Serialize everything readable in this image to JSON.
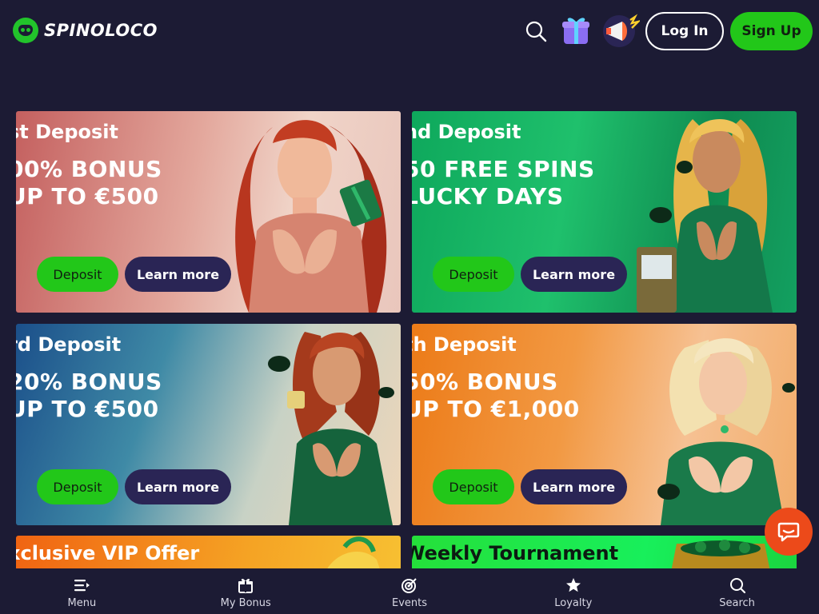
{
  "header": {
    "logo_text": "SPINOLOCO",
    "login_label": "Log In",
    "signup_label": "Sign Up"
  },
  "promos": [
    {
      "title": "st Deposit",
      "line1": "00% BONUS",
      "line2": "UP TO €500",
      "deposit_label": "Deposit",
      "learn_label": "Learn more"
    },
    {
      "title": "nd Deposit",
      "line1": "50 FREE SPINS",
      "line2": "LUCKY DAYS",
      "deposit_label": "Deposit",
      "learn_label": "Learn more"
    },
    {
      "title": "rd Deposit",
      "line1": "20% BONUS",
      "line2": "UP TO €500",
      "deposit_label": "Deposit",
      "learn_label": "Learn more"
    },
    {
      "title": "th Deposit",
      "line1": "50% BONUS",
      "line2": "UP TO €1,000",
      "deposit_label": "Deposit",
      "learn_label": "Learn more"
    },
    {
      "title": "xclusive VIP Offer"
    },
    {
      "title": "Weekly Tournament"
    }
  ],
  "bottom_nav": [
    {
      "label": "Menu",
      "icon": "menu-icon"
    },
    {
      "label": "My Bonus",
      "icon": "gift-icon"
    },
    {
      "label": "Events",
      "icon": "target-icon"
    },
    {
      "label": "Loyalty",
      "icon": "star-icon"
    },
    {
      "label": "Search",
      "icon": "search-icon"
    }
  ],
  "colors": {
    "background": "#1c1b34",
    "accent_green": "#22c719",
    "learn_button": "#2a2555",
    "chat_button": "#ec4a1a"
  }
}
